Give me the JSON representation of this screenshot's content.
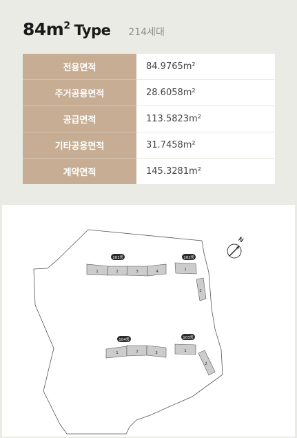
{
  "header": {
    "area": "84m",
    "sup": "2",
    "type": "Type",
    "units": "214세대"
  },
  "specs": [
    {
      "label": "전용면적",
      "value": "84.9765m²"
    },
    {
      "label": "주거공용면적",
      "value": "28.6058m²"
    },
    {
      "label": "공급면적",
      "value": "113.5823m²"
    },
    {
      "label": "기타공용면적",
      "value": "31.7458m²"
    },
    {
      "label": "계약면적",
      "value": "145.3281m²"
    }
  ],
  "site_map": {
    "compass": "N",
    "buildings": [
      {
        "name": "101동",
        "units": [
          "1",
          "2",
          "3",
          "4"
        ]
      },
      {
        "name": "102동",
        "units": [
          "1",
          "2"
        ]
      },
      {
        "name": "103동",
        "units": [
          "1",
          "2"
        ]
      },
      {
        "name": "104동",
        "units": [
          "1",
          "2",
          "3"
        ]
      }
    ]
  }
}
